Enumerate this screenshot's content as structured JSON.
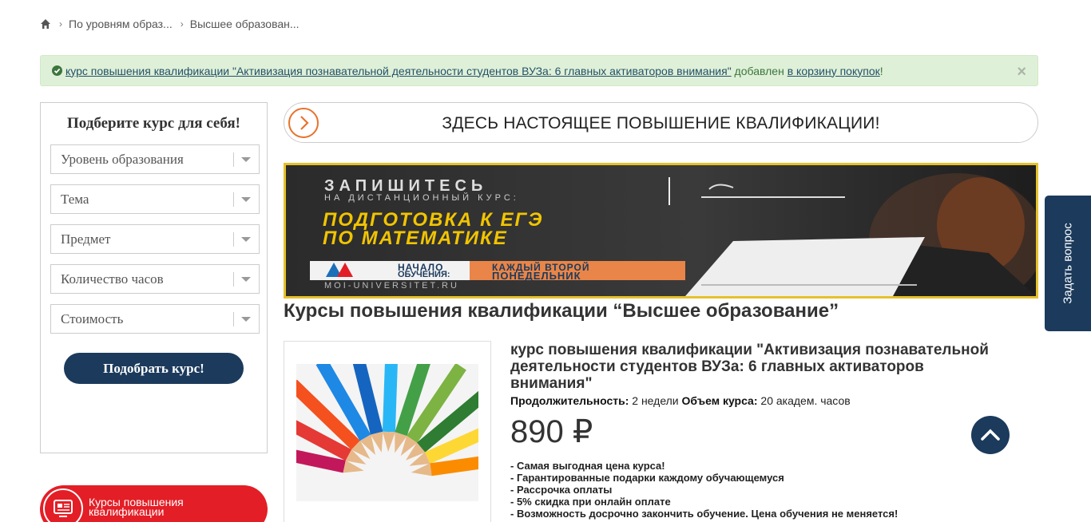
{
  "breadcrumb": {
    "icon": "home-icon",
    "items": [
      "По уровням образ...",
      "Высшее образован..."
    ]
  },
  "alert": {
    "icon": "check-circle-icon",
    "course_link": "курс повышения квалификации \"Активизация познавательной деятельности студентов ВУЗа: 6 главных активаторов внимания\"",
    "middle": " добавлен ",
    "cart_link": "в корзину покупок",
    "tail": "!",
    "close": "×"
  },
  "sidebar": {
    "title": "Подберите курс для себя!",
    "filters": [
      "Уровень образования",
      "Тема",
      "Предмет",
      "Количество часов",
      "Стоимость"
    ],
    "button": "Подобрать курс!",
    "courses_pill": "Курсы повышения квалификации"
  },
  "banner": {
    "text": "ЗДЕСЬ НАСТОЯЩЕЕ ПОВЫШЕНИЕ КВАЛИФИКАЦИИ!"
  },
  "ad": {
    "line1": "ЗАПИШИТЕСЬ",
    "line2": "НА ДИСТАНЦИОННЫЙ КУРС:",
    "title1": "ПОДГОТОВКА К ЕГЭ",
    "title2": "ПО МАТЕМАТИКЕ",
    "start1": "НАЧАЛО",
    "start2": "ОБУЧЕНИЯ:",
    "when1": "КАЖДЫЙ ВТОРОЙ",
    "when2": "ПОНЕДЕЛЬНИК",
    "site": "MOI-UNIVERSITET.RU"
  },
  "page_heading": "Курсы повышения квалификации “Высшее образование”",
  "course": {
    "title": "курс повышения квалификации \"Активизация познавательной деятельности студентов ВУЗа: 6 главных активаторов внимания\"",
    "duration_label": "Продолжительность:",
    "duration_value": " 2 недели ",
    "volume_label": "Объем курса:",
    "volume_value": " 20 академ. часов",
    "price": "890 ₽",
    "benefits": [
      "- Самая выгодная цена курса!",
      "- Гарантированные подарки каждому обучающемуся",
      "- Рассрочка оплаты",
      "- 5% скидка при онлайн оплате",
      "- Возможность досрочно закончить обучение. Цена обучения не меняется!"
    ]
  },
  "ask_tab": "Задать вопрос",
  "colors": {
    "navy": "#1b3a5c",
    "red": "#e41e26",
    "orange": "#e8722a",
    "alert_bg": "#dff0d8"
  }
}
